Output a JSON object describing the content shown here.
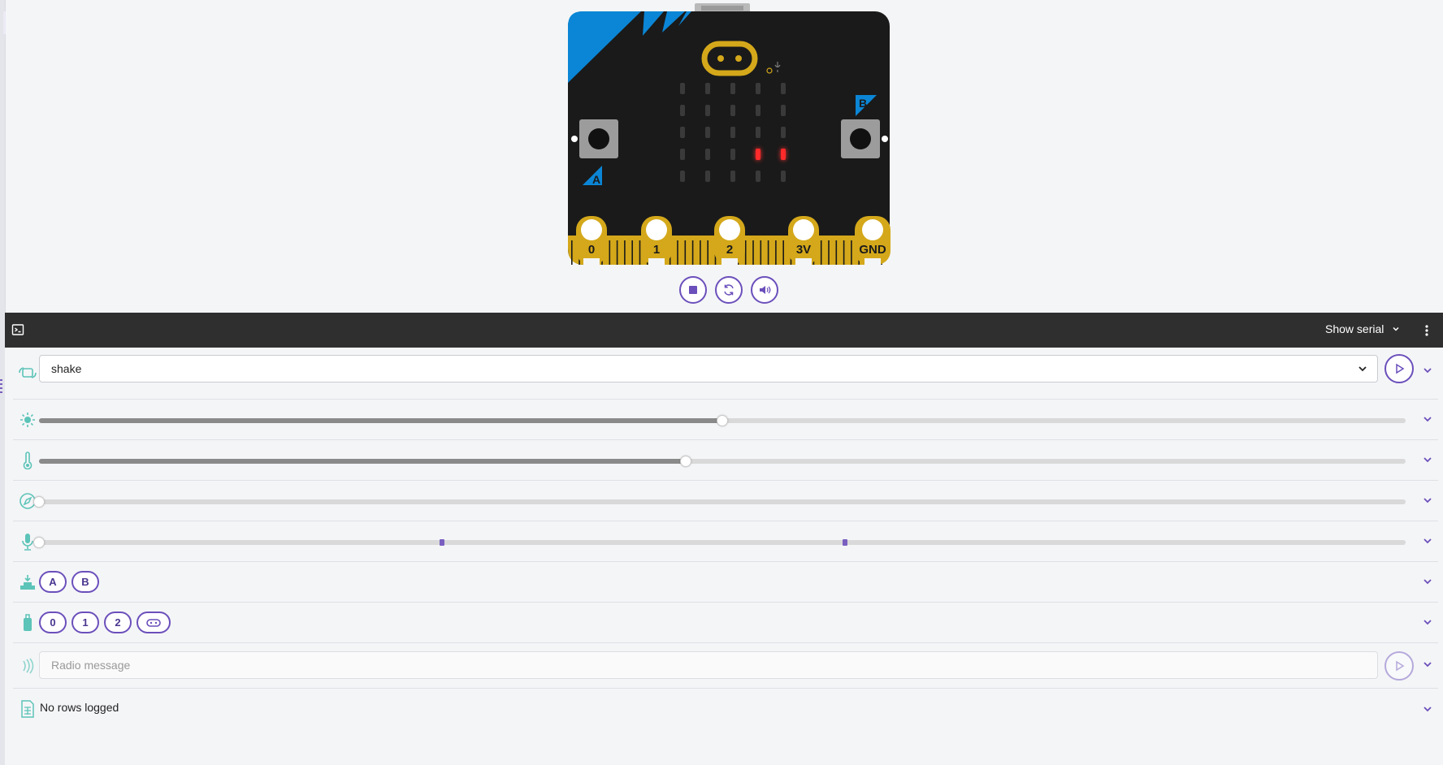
{
  "serial": {
    "show_serial_label": "Show serial"
  },
  "board": {
    "pins": [
      "0",
      "1",
      "2",
      "3V",
      "GND"
    ],
    "button_a_label": "A",
    "button_b_label": "B",
    "lit_leds": [
      [
        3,
        3
      ],
      [
        3,
        4
      ]
    ]
  },
  "controls": {
    "icons": [
      "stop-icon",
      "restart-icon",
      "volume-icon"
    ]
  },
  "accelerometer": {
    "selected_gesture": "shake",
    "icon": "gesture-icon"
  },
  "light": {
    "icon": "sun-icon",
    "value_fraction": 0.5
  },
  "temperature": {
    "icon": "thermometer-icon",
    "value_fraction": 0.473
  },
  "compass": {
    "icon": "compass-icon",
    "value_fraction": 0.0
  },
  "sound": {
    "icon": "microphone-icon",
    "value_fraction": 0.0,
    "thresholds_fraction": [
      0.295,
      0.59
    ]
  },
  "buttons": {
    "icon": "button-press-icon",
    "labels": [
      "A",
      "B"
    ]
  },
  "pins": {
    "icon": "pin-icon",
    "labels": [
      "0",
      "1",
      "2"
    ],
    "logo_icon": "logo-touch-icon"
  },
  "radio": {
    "icon": "radio-waves-icon",
    "placeholder": "Radio message"
  },
  "data_logging": {
    "icon": "spreadsheet-icon",
    "status": "No rows logged"
  },
  "colors": {
    "accent": "#6b4fbb",
    "sensor_icon": "#5cc4b8",
    "board_black": "#1a1a1a",
    "board_blue": "#0b86d6",
    "board_gold": "#d4a81a",
    "led_on": "#ff2a2a"
  }
}
